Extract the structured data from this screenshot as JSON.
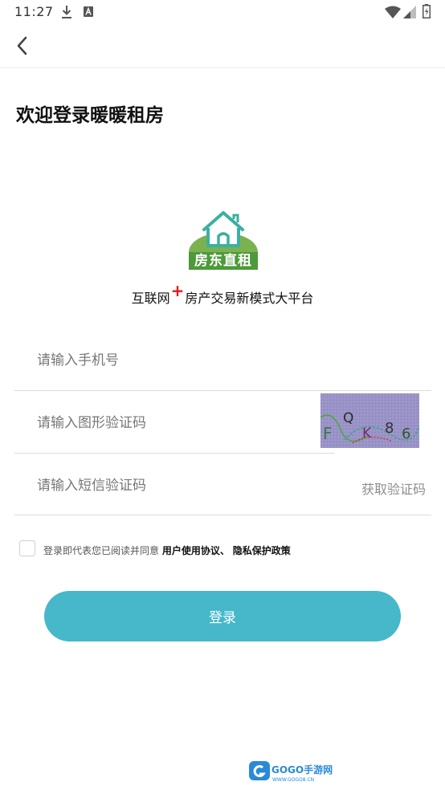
{
  "status_bar": {
    "time": "11:27",
    "icons": [
      "download-icon",
      "notification-a-icon",
      "wifi-icon",
      "signal-icon",
      "battery-icon"
    ]
  },
  "app_bar": {
    "back_icon": "chevron-left-icon"
  },
  "page_title": "欢迎登录暖暖租房",
  "logo": {
    "text": "房东直租",
    "icon": "house-icon"
  },
  "slogan": {
    "part1": "互联网",
    "plus": "+",
    "part2": "房产交易新模式大平台"
  },
  "form": {
    "phone_placeholder": "请输入手机号",
    "captcha_placeholder": "请输入图形验证码",
    "captcha_text": "FQK86",
    "sms_placeholder": "请输入短信验证码",
    "get_code_label": "获取验证码"
  },
  "agreement": {
    "prefix": "登录即代表您已阅读并同意",
    "user_agreement": "用户使用协议、",
    "privacy_policy": "隐私保护政策"
  },
  "login_label": "登录",
  "watermark": {
    "brand": "GOGO手游网",
    "url": "WWW.GOGO8.CN"
  },
  "colors": {
    "primary": "#46b8ca",
    "logo_green": "#4c9a3a",
    "logo_teal": "#3bb0a0",
    "slogan_plus": "#e41a1a"
  }
}
